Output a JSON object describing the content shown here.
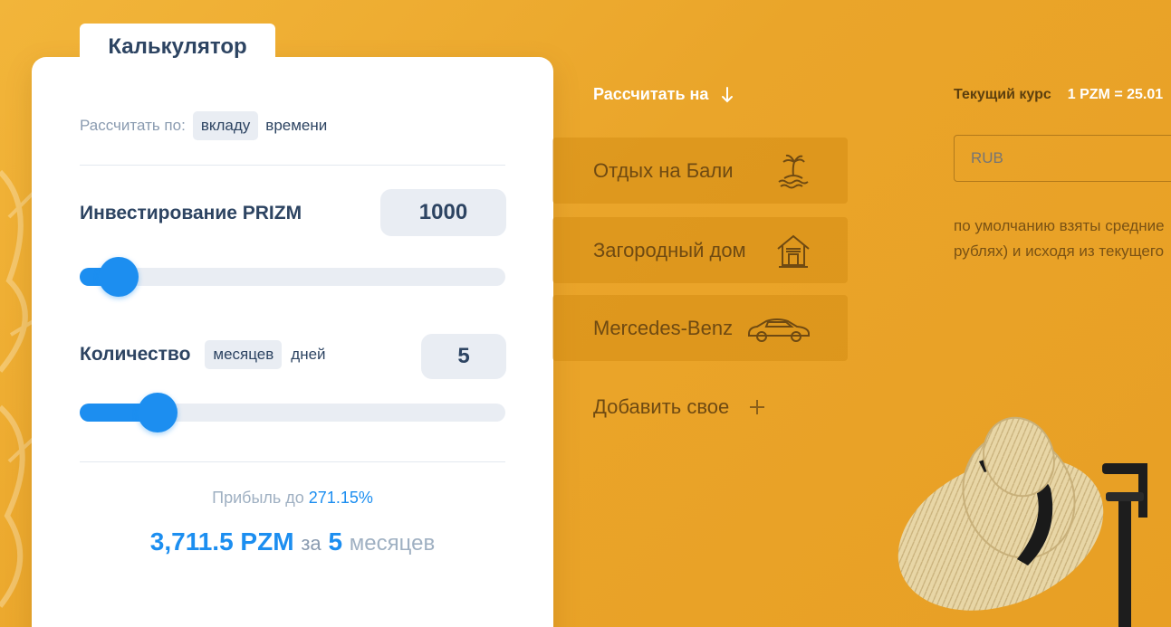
{
  "calculator": {
    "tab_label": "Калькулятор",
    "calc_by_label": "Рассчитать по:",
    "calc_by_options": [
      "вкладу",
      "времени"
    ],
    "investment_label": "Инвестирование PRIZM",
    "investment_value": "1000",
    "investment_slider_fraction": 0.05,
    "quantity_label": "Количество",
    "quantity_unit_options": [
      "месяцев",
      "дней"
    ],
    "quantity_value": "5",
    "quantity_slider_fraction": 0.15,
    "profit_prefix": "Прибыль до",
    "profit_percent": "271.15%",
    "result_amount": "3,711.5 PZM",
    "result_for": "за",
    "result_period_number": "5",
    "result_period_unit": "месяцев"
  },
  "goals": {
    "header": "Рассчитать на",
    "items": [
      {
        "label": "Отдых на Бали",
        "icon": "palm-island-icon"
      },
      {
        "label": "Загородный дом",
        "icon": "house-icon"
      },
      {
        "label": "Mercedes-Benz",
        "icon": "car-icon"
      }
    ],
    "add_label": "Добавить свое"
  },
  "rate": {
    "label": "Текущий курс",
    "value": "1 PZM = 25.01",
    "currency_placeholder": "RUB",
    "note_line1": "по умолчанию взяты средние",
    "note_line2": "рублях) и исходя из текущего"
  },
  "colors": {
    "accent": "#1c8ef0",
    "background": "#eaa52a",
    "text_dark": "#2d4462"
  }
}
